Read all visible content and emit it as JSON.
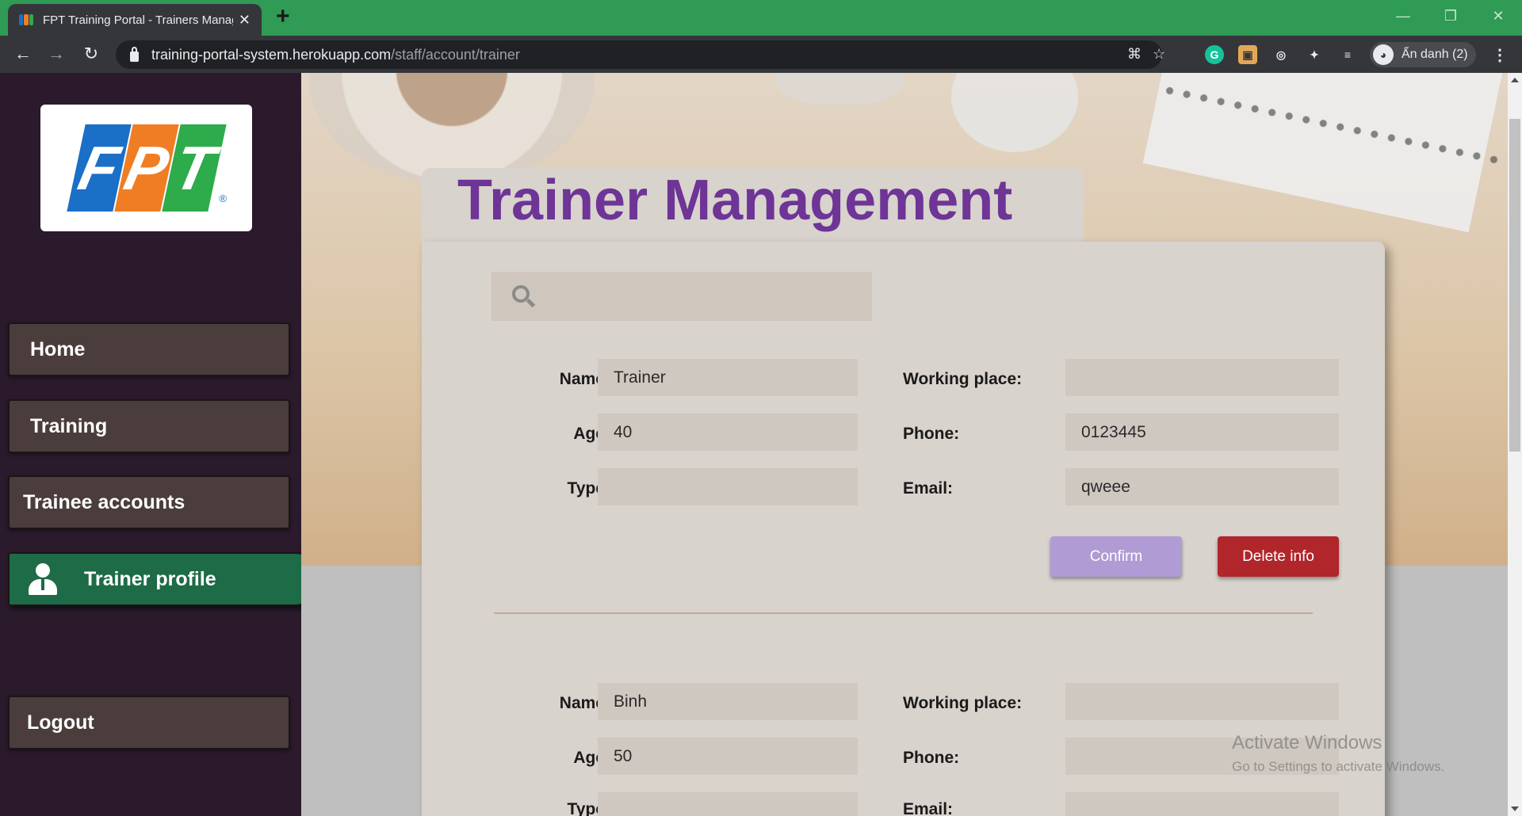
{
  "browser": {
    "tab_title": "FPT Training Portal - Trainers Manag",
    "url_host": "training-portal-system.herokuapp.com",
    "url_path": "/staff/account/trainer",
    "profile_label": "Ẩn danh (2)",
    "icons": [
      "back-icon",
      "forward-icon",
      "reload-icon",
      "lock-icon",
      "translate-icon",
      "star-icon",
      "grammarly-icon",
      "extension-icon",
      "puzzle-icon",
      "reading-list-icon",
      "incognito-icon",
      "menu-icon"
    ]
  },
  "logo": {
    "letters": [
      "F",
      "P",
      "T"
    ],
    "colors": [
      "#1a6fc7",
      "#f07d23",
      "#2eab4b"
    ],
    "reg_mark": "®"
  },
  "sidebar": {
    "items": [
      {
        "label": "Home"
      },
      {
        "label": "Training"
      },
      {
        "label": "Trainee accounts"
      },
      {
        "label": "Trainer profile",
        "active": true
      },
      {
        "label": "Logout"
      }
    ]
  },
  "main": {
    "title": "Trainer Management",
    "search_placeholder": "",
    "labels": {
      "name": "Name:",
      "age": "Age:",
      "type": "Type:",
      "working_place": "Working place:",
      "phone": "Phone:",
      "email": "Email:"
    },
    "records": [
      {
        "name": "Trainer",
        "age": "40",
        "type": "",
        "working_place": "",
        "phone": "0123445",
        "email": "qweee"
      },
      {
        "name": "Binh",
        "age": "50",
        "type": "",
        "working_place": "",
        "phone": "",
        "email": ""
      }
    ],
    "confirm_label": "Confirm",
    "delete_label": "Delete info"
  },
  "watermark": {
    "title": "Activate Windows",
    "subtitle": "Go to Settings to activate Windows."
  },
  "colors": {
    "tabbar": "#2f9b55",
    "sidebar": "#2a1a2c",
    "nav_item": "#4a3d3b",
    "nav_active": "#1e6b47",
    "title": "#6e3496",
    "confirm": "#b09bd5",
    "delete": "#b0262b"
  }
}
